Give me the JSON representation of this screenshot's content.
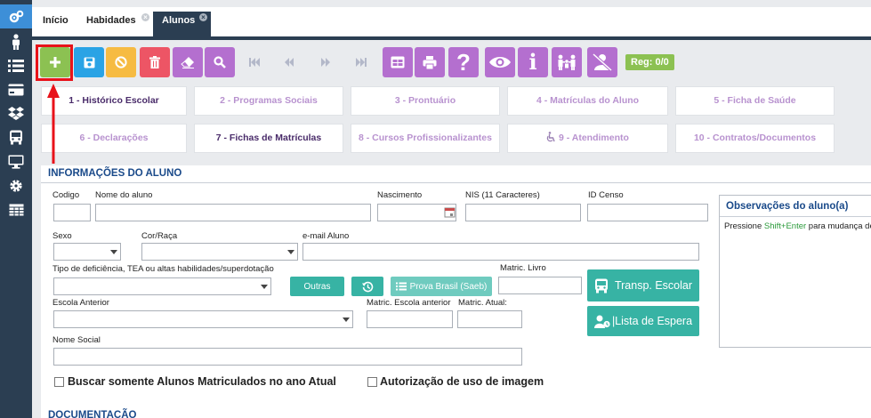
{
  "tabs": [
    {
      "label": "Início",
      "closable": false
    },
    {
      "label": "Habidades",
      "closable": true
    },
    {
      "label": "Alunos",
      "closable": true,
      "active": true
    }
  ],
  "sidebar": {
    "items": [
      {
        "icon": "gears-icon",
        "active": true
      },
      {
        "icon": "student-icon"
      },
      {
        "icon": "list-icon"
      },
      {
        "icon": "card-icon"
      },
      {
        "icon": "dropbox-icon"
      },
      {
        "icon": "bus-icon"
      },
      {
        "icon": "monitor-icon"
      },
      {
        "icon": "gear-icon"
      },
      {
        "icon": "table-icon"
      }
    ]
  },
  "toolbar": {
    "buttons": [
      {
        "name": "add",
        "color": "#8cc152",
        "icon": "plus-icon",
        "label": "+"
      },
      {
        "name": "save",
        "color": "#2aa3e5",
        "icon": "floppy-icon"
      },
      {
        "name": "cancel",
        "color": "#f6bb42",
        "icon": "ban-icon"
      },
      {
        "name": "delete",
        "color": "#ed5565",
        "icon": "trash-icon"
      },
      {
        "name": "clear",
        "color": "#b46fcf",
        "icon": "eraser-icon"
      },
      {
        "name": "search",
        "color": "#b46fcf",
        "icon": "search-icon"
      },
      {
        "name": "first",
        "icon": "first-icon"
      },
      {
        "name": "prev",
        "icon": "prev-icon"
      },
      {
        "name": "next",
        "icon": "next-icon"
      },
      {
        "name": "last",
        "icon": "last-icon"
      },
      {
        "name": "report",
        "color": "#b46fcf",
        "icon": "report-icon"
      },
      {
        "name": "print",
        "color": "#b46fcf",
        "icon": "print-icon"
      },
      {
        "name": "help",
        "color": "#b46fcf",
        "icon": "question-icon",
        "label": "?"
      },
      {
        "name": "view",
        "color": "#b46fcf",
        "icon": "eye-icon"
      },
      {
        "name": "info",
        "color": "#b46fcf",
        "icon": "info-icon",
        "label": "i"
      },
      {
        "name": "family",
        "color": "#b46fcf",
        "icon": "family-icon"
      },
      {
        "name": "user-off",
        "color": "#b46fcf",
        "icon": "user-slash-icon"
      }
    ],
    "reg_label": "Reg: 0/0"
  },
  "form_tabs": {
    "row1": [
      "1 - Histórico Escolar",
      "2 - Programas Sociais",
      "3 - Prontuário",
      "4 - Matrículas do Aluno",
      "5 - Ficha de Saúde"
    ],
    "row2": [
      "6 - Declarações",
      "7 - Fichas de Matrículas",
      "8 - Cursos Profissionalizantes",
      "9 - Atendimento",
      "10 - Contratos/Documentos"
    ],
    "atendimento_icon": "wheelchair-icon"
  },
  "info_panel": {
    "title": "INFORMAÇÕES DO ALUNO",
    "labels": {
      "codigo": "Codigo",
      "nome": "Nome do aluno",
      "nascimento": "Nascimento",
      "nis": "NIS (11 Caracteres)",
      "id_censo": "ID Censo",
      "sexo": "Sexo",
      "cor_raca": "Cor/Raça",
      "email": "e-mail Aluno",
      "deficiencia": "Tipo de deficiência, TEA ou altas habilidades/superdotação",
      "matric_livro": "Matric. Livro",
      "escola_anterior": "Escola Anterior",
      "matric_escola_anterior": "Matric. Escola anterior",
      "matric_atual": "Matric. Atual:",
      "nome_social": "Nome Social"
    },
    "buttons": {
      "outras": "Outras",
      "prova_brasil": "Prova Brasil (Saeb)",
      "transp_escolar": "Transp. Escolar",
      "lista_espera": "|Lista de Espera"
    },
    "checkboxes": {
      "buscar": "Buscar somente Alunos Matriculados no ano Atual",
      "autorizacao": "Autorização de uso de imagem"
    },
    "observacoes": {
      "title": "Observações do aluno(a)",
      "hint_prefix": "Pressione ",
      "hint_key": "Shift+Enter",
      "hint_suffix": " para mudança de"
    }
  },
  "documentacao_title": "DOCUMENTAÇÃO"
}
